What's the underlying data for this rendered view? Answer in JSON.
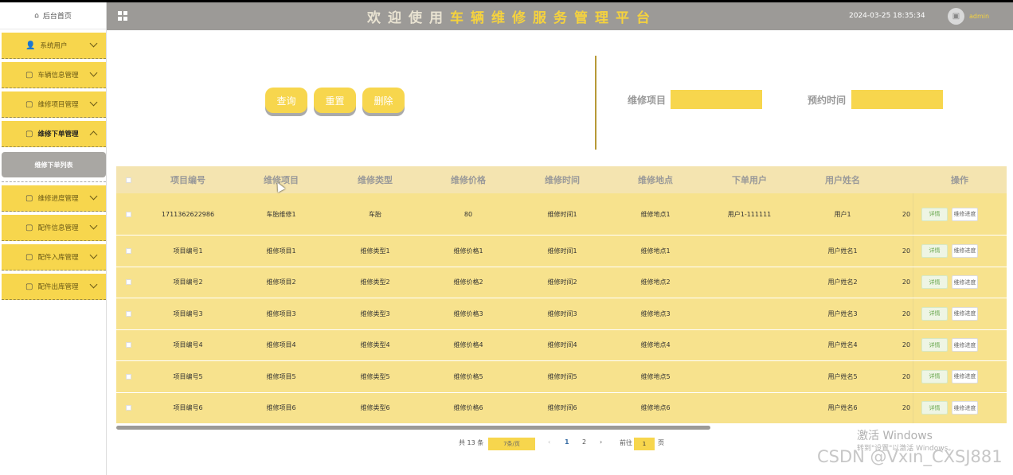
{
  "header": {
    "title": "欢迎使用车辆维修服务管理平台",
    "datetime": "2024-03-25 18:35:34",
    "username": "admin"
  },
  "sidebar": {
    "home": "后台首页",
    "items": [
      {
        "label": "系统用户",
        "icon": "user-icon"
      },
      {
        "label": "车辆信息管理",
        "icon": "document-icon"
      },
      {
        "label": "维修项目管理",
        "icon": "document-icon"
      },
      {
        "label": "维修下单管理",
        "icon": "document-icon",
        "expanded": true
      },
      {
        "label": "维修进度管理",
        "icon": "document-icon"
      },
      {
        "label": "配件信息管理",
        "icon": "document-icon"
      },
      {
        "label": "配件入库管理",
        "icon": "document-icon"
      },
      {
        "label": "配件出库管理",
        "icon": "document-icon"
      }
    ],
    "submenu": "维修下单列表"
  },
  "actions": {
    "query": "查询",
    "reset": "重置",
    "delete": "删除"
  },
  "filters": {
    "item_label": "维修项目",
    "time_label": "预约时间"
  },
  "table": {
    "columns": [
      "项目编号",
      "维修项目",
      "维修类型",
      "维修价格",
      "维修时间",
      "维修地点",
      "下单用户",
      "用户姓名",
      "操作"
    ],
    "rows": [
      [
        "1711362622986",
        "车胎维修1",
        "车胎",
        "80",
        "维修时间1",
        "维修地点1",
        "用户1-111111",
        "用户1",
        "20"
      ],
      [
        "项目编号1",
        "维修项目1",
        "维修类型1",
        "维修价格1",
        "维修时间1",
        "维修地点1",
        "",
        "用户姓名1",
        "20"
      ],
      [
        "项目编号2",
        "维修项目2",
        "维修类型2",
        "维修价格2",
        "维修时间2",
        "维修地点2",
        "",
        "用户姓名2",
        "20"
      ],
      [
        "项目编号3",
        "维修项目3",
        "维修类型3",
        "维修价格3",
        "维修时间3",
        "维修地点3",
        "",
        "用户姓名3",
        "20"
      ],
      [
        "项目编号4",
        "维修项目4",
        "维修类型4",
        "维修价格4",
        "维修时间4",
        "维修地点4",
        "",
        "用户姓名4",
        "20"
      ],
      [
        "项目编号5",
        "维修项目5",
        "维修类型5",
        "维修价格5",
        "维修时间5",
        "维修地点5",
        "",
        "用户姓名5",
        "20"
      ],
      [
        "项目编号6",
        "维修项目6",
        "维修类型6",
        "维修价格6",
        "维修时间6",
        "维修地点6",
        "",
        "用户姓名6",
        "20"
      ]
    ],
    "detail_btn": "详情",
    "progress_btn": "维修进度"
  },
  "pagination": {
    "total": "共 13 条",
    "page_size": "7条/页",
    "prev": "‹",
    "pages": [
      "1",
      "2"
    ],
    "next": "›",
    "goto": "前往",
    "goto_value": "1",
    "page_unit": "页"
  },
  "watermark": {
    "activate": "激活 Windows",
    "activate_hint": "转到\"设置\"以激活 Windows。",
    "csdn": "CSDN @Vxin_CXSJ881"
  }
}
